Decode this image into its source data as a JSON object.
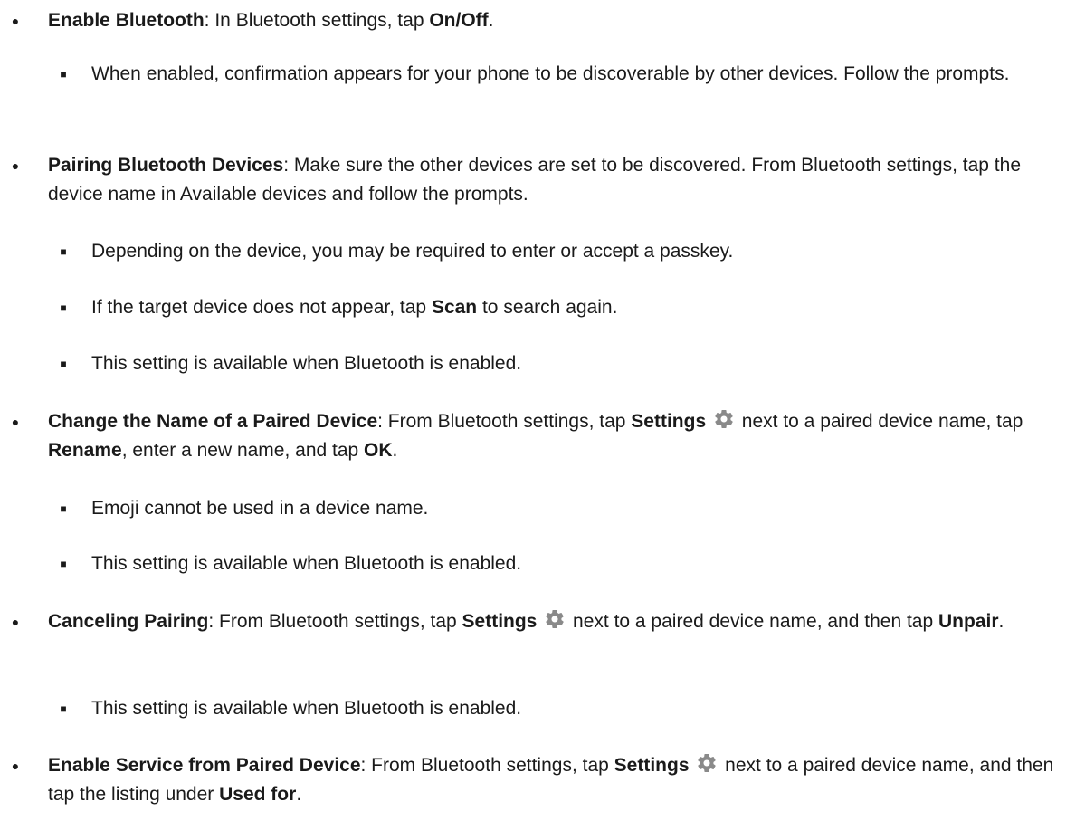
{
  "sections": {
    "bluetooth_enable": {
      "title": "Enable Bluetooth",
      "t1": ": In Bluetooth settings, tap ",
      "b1": "On/Off",
      "t2": ".",
      "sub1": "When enabled, confirmation appears for your phone to be discoverable by other devices. Follow the prompts."
    },
    "pairing": {
      "title": "Pairing Bluetooth Devices",
      "t1": ": Make sure the other devices are set to be discovered. From Bluetooth settings, tap the device name in Available devices and follow the prompts.",
      "sub1": "Depending on the device, you may be required to enter or accept a passkey.",
      "sub2_t1": "If the target device does not appear, tap ",
      "sub2_b1": "Scan",
      "sub2_t2": " to search again.",
      "sub3": "This setting is available when Bluetooth is enabled."
    },
    "rename": {
      "title": "Change the Name of a Paired Device",
      "t1": ": From Bluetooth settings, tap ",
      "b1": "Settings",
      "t2": " next to a paired device name, tap ",
      "b2": "Rename",
      "t3": ", enter a new name, and tap ",
      "b3": "OK",
      "t4": ".",
      "sub1": "Emoji cannot be used in a device name.",
      "sub2": "This setting is available when Bluetooth is enabled."
    },
    "cancel": {
      "title": "Canceling Pairing",
      "t1": ": From Bluetooth settings, tap ",
      "b1": "Settings",
      "t2": " next to a paired device name, and then tap ",
      "b2": "Unpair",
      "t3": ".",
      "sub1": "This setting is available when Bluetooth is enabled."
    },
    "service": {
      "title": "Enable Service from Paired Device",
      "t1": ": From Bluetooth settings, tap ",
      "b1": "Settings",
      "t2": " next to a paired device name, and then tap the listing under ",
      "b2": "Used for",
      "t3": "."
    }
  },
  "bullets": {
    "main": "●",
    "sub": "■"
  },
  "icons": {
    "settings": "gear-icon"
  },
  "colors": {
    "text": "#1a1a1a",
    "gear": "#8a8a8a"
  }
}
